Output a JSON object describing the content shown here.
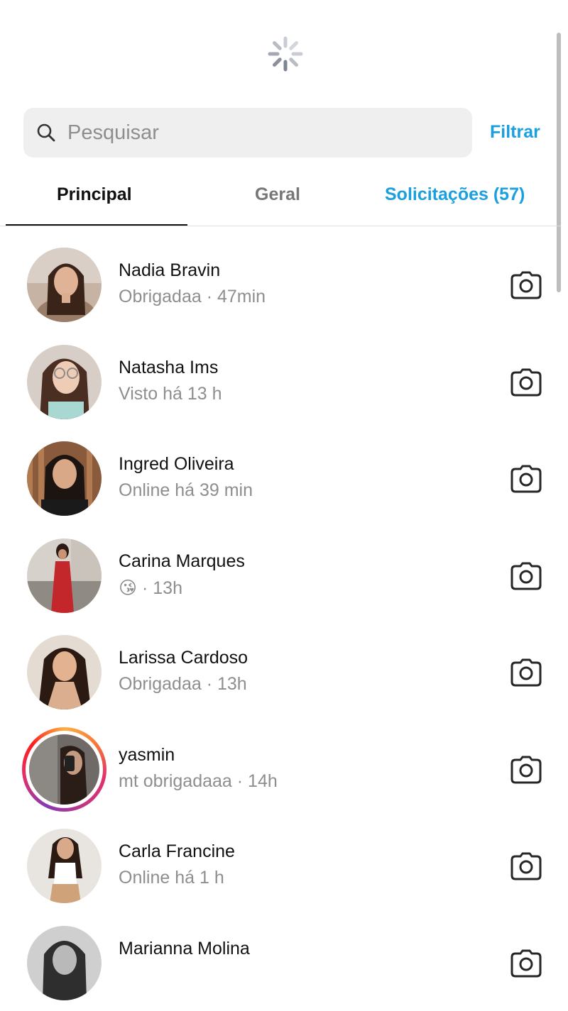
{
  "search": {
    "placeholder": "Pesquisar",
    "filter_label": "Filtrar"
  },
  "tabs": [
    {
      "label": "Principal",
      "active": true
    },
    {
      "label": "Geral",
      "active": false
    },
    {
      "label": "Solicitações (57)",
      "active": false
    }
  ],
  "conversations": [
    {
      "name": "Nadia Bravin",
      "preview": "Obrigadaa · 47min",
      "has_story": false
    },
    {
      "name": "Natasha Ims",
      "preview": "Visto há 13 h",
      "has_story": false
    },
    {
      "name": "Ingred Oliveira",
      "preview": "Online há 39 min",
      "has_story": false
    },
    {
      "name": "Carina Marques",
      "preview": "😘 · 13h",
      "has_story": false
    },
    {
      "name": "Larissa Cardoso",
      "preview": "Obrigadaa · 13h",
      "has_story": false
    },
    {
      "name": "yasmin",
      "preview": "mt obrigadaaa · 14h",
      "has_story": true
    },
    {
      "name": "Carla Francine",
      "preview": "Online há 1 h",
      "has_story": false
    },
    {
      "name": "Marianna Molina",
      "preview": "",
      "has_story": false
    }
  ],
  "icons": {
    "loading": "loading-spinner-icon",
    "search": "search-icon",
    "camera": "camera-icon"
  },
  "colors": {
    "accent": "#1a9fe0",
    "muted_text": "#8e8e8e",
    "search_bg": "#efefef"
  }
}
